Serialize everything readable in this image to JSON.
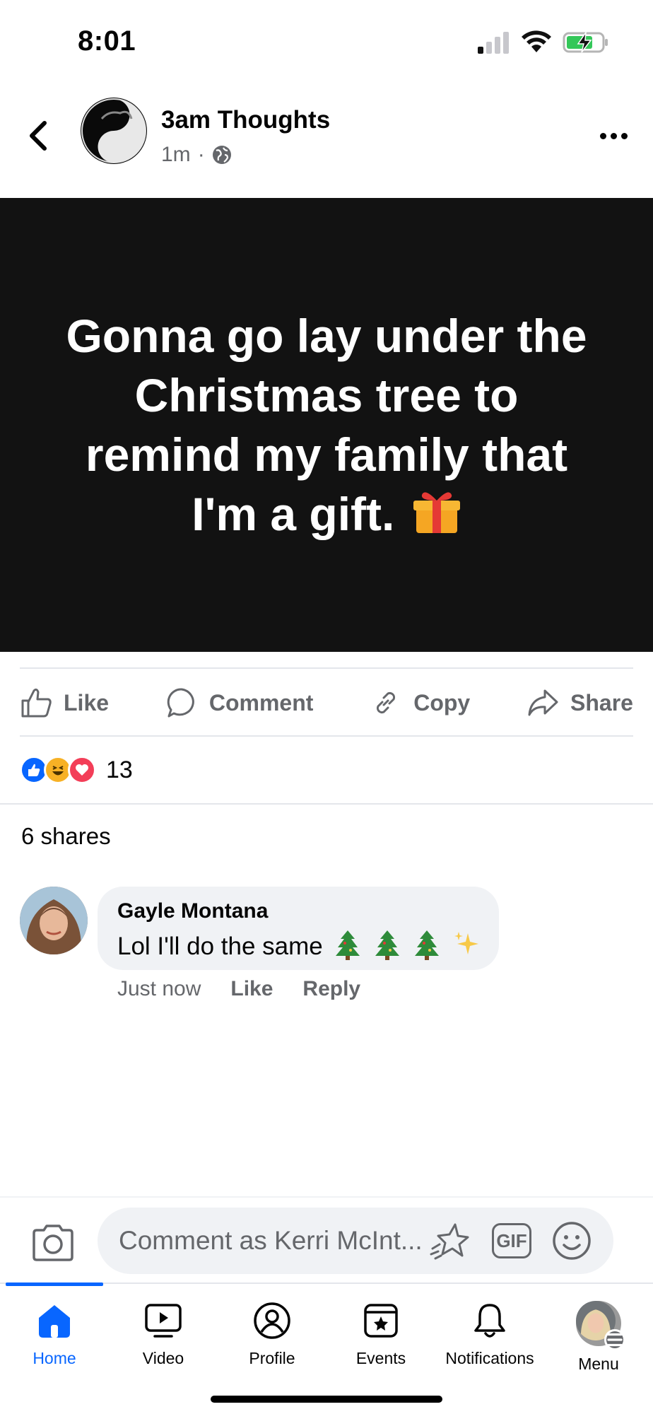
{
  "status_bar": {
    "time": "8:01"
  },
  "post": {
    "page_name": "3am Thoughts",
    "time_ago": "1m",
    "separator": "·",
    "body_text": "Gonna go lay under the Christmas tree to remind my family that I'm a gift.",
    "body_emoji": "gift-emoji",
    "background_color": "#121212"
  },
  "actions": {
    "like_label": "Like",
    "comment_label": "Comment",
    "copy_label": "Copy",
    "share_label": "Share"
  },
  "reactions": {
    "types": [
      "like",
      "haha",
      "love"
    ],
    "count": "13"
  },
  "shares_text": "6 shares",
  "comment": {
    "author": "Gayle Montana",
    "text": "Lol I'll do the same",
    "emojis": [
      "christmas-tree",
      "christmas-tree",
      "christmas-tree",
      "sparkles"
    ],
    "time": "Just now",
    "like_label": "Like",
    "reply_label": "Reply"
  },
  "composer": {
    "placeholder": "Comment as Kerri McInt...",
    "gif_label": "GIF"
  },
  "tabbar": {
    "home": "Home",
    "video": "Video",
    "profile": "Profile",
    "events": "Events",
    "notifications": "Notifications",
    "menu": "Menu",
    "active": "home"
  },
  "colors": {
    "accent": "#0866ff",
    "secondary_text": "#65676b",
    "bubble": "#f0f2f5"
  }
}
